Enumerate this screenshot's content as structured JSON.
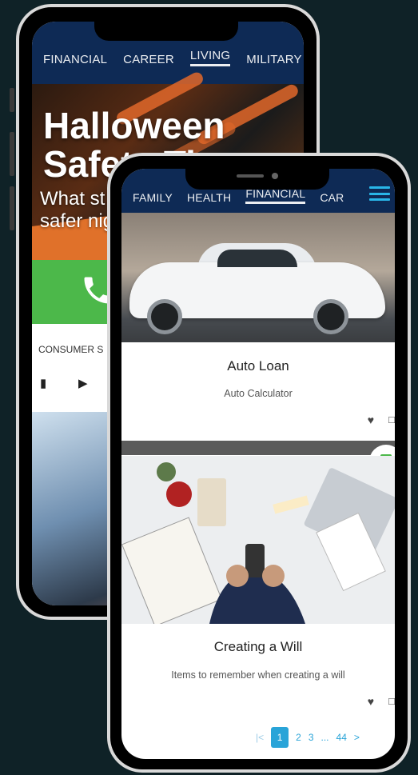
{
  "back_phone": {
    "nav_tabs": [
      "FINANCIAL",
      "CAREER",
      "LIVING",
      "MILITARY"
    ],
    "active_tab": "LIVING",
    "hero_title_line1": "Halloween",
    "hero_title_line2": "Safety Tips",
    "hero_sub_line1": "What st",
    "hero_sub_line2": "safer nig",
    "consumer_label": "CONSUMER S",
    "icons": [
      "document-icon",
      "play-icon"
    ]
  },
  "front_phone": {
    "nav_tabs": [
      "FAMILY",
      "HEALTH",
      "FINANCIAL",
      "CAR"
    ],
    "active_tab": "FINANCIAL",
    "cards": [
      {
        "title": "Auto Loan",
        "subtitle": "Auto Calculator"
      },
      {
        "title": "Creating a Will",
        "subtitle": "Items to remember when creating a will"
      }
    ],
    "pagination": {
      "first": "|<",
      "current": "1",
      "pages": [
        "2",
        "3",
        "...",
        "44"
      ],
      "next": ">"
    }
  },
  "colors": {
    "background": "#0f2227",
    "nav": "#0e2a55",
    "accent": "#29a4d8",
    "green": "#4cb84a"
  }
}
